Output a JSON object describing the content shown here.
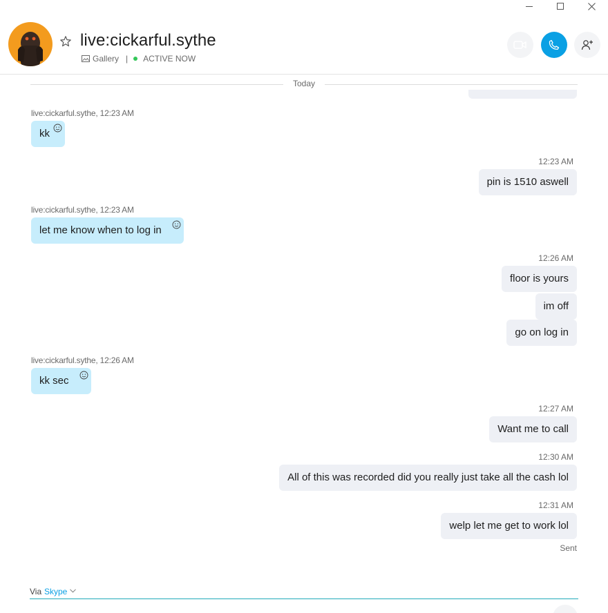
{
  "header": {
    "contact_name": "live:cickarful.sythe",
    "gallery_label": "Gallery",
    "separator": "|",
    "status": "ACTIVE NOW"
  },
  "chat": {
    "date_divider": "Today",
    "messages": [
      {
        "direction": "in",
        "meta": "live:cickarful.sythe, 12:23 AM",
        "text": "kk"
      },
      {
        "direction": "out",
        "meta": "12:23 AM",
        "text": "pin is 1510 aswell"
      },
      {
        "direction": "in",
        "meta": "live:cickarful.sythe, 12:23 AM",
        "text": "let me know when to log in"
      },
      {
        "direction": "out",
        "meta": "12:26 AM",
        "texts": [
          "floor is yours",
          "im off",
          "go on log in"
        ]
      },
      {
        "direction": "in",
        "meta": "live:cickarful.sythe, 12:26 AM",
        "text": "kk sec"
      },
      {
        "direction": "out",
        "meta": "12:27 AM",
        "text": "Want me to call"
      },
      {
        "direction": "out",
        "meta": "12:30 AM",
        "text": "All of this was recorded did you really just take all the cash lol"
      },
      {
        "direction": "out",
        "meta": "12:31 AM",
        "text": "welp let me get to work lol"
      }
    ],
    "sent_status": "Sent"
  },
  "composer": {
    "via_label": "Via",
    "service_label": "Skype"
  },
  "colors": {
    "accent": "#0aa0e4",
    "incoming_bubble": "#c7edfc",
    "outgoing_bubble": "#eef0f5",
    "online": "#34c759",
    "avatar_bg": "#f39b1e"
  },
  "icons": [
    "minimize-icon",
    "maximize-icon",
    "close-icon",
    "star-icon",
    "gallery-icon",
    "video-call-icon",
    "phone-icon",
    "add-person-icon",
    "emoji-icon",
    "chevron-down-icon"
  ]
}
